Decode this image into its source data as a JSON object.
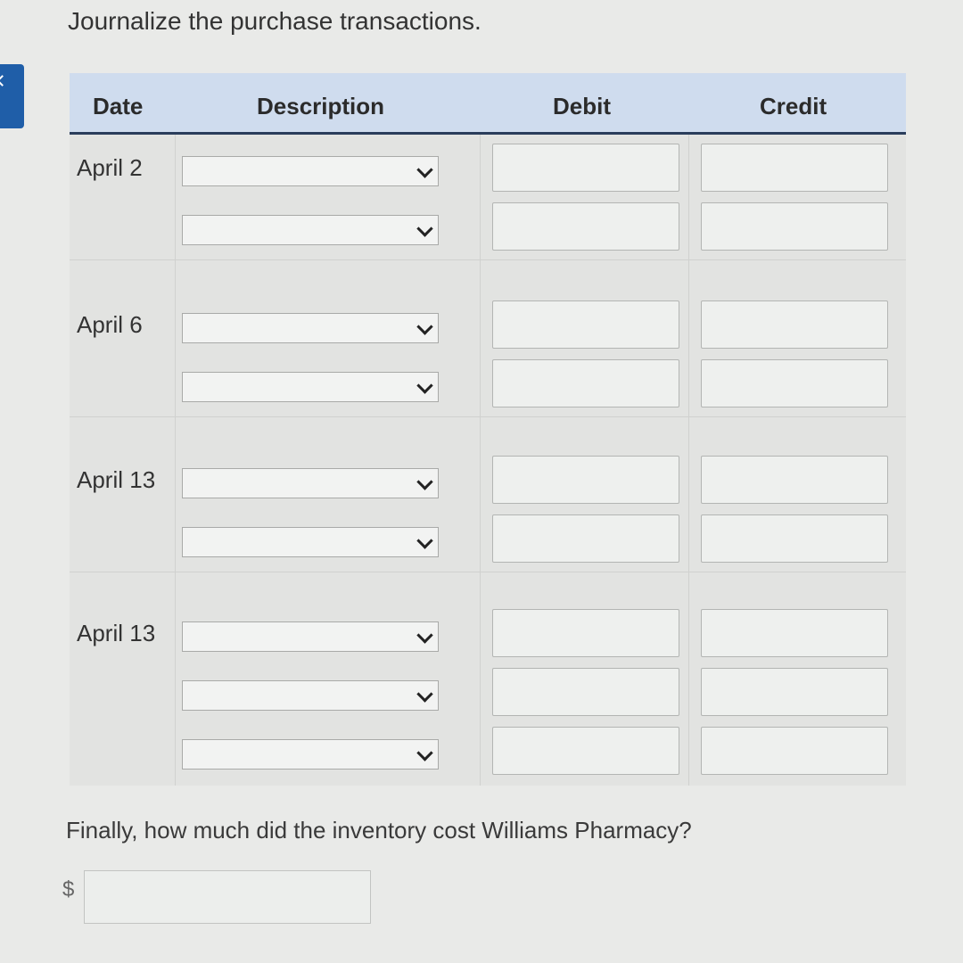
{
  "instruction": "Journalize the purchase transactions.",
  "headers": {
    "date": "Date",
    "description": "Description",
    "debit": "Debit",
    "credit": "Credit"
  },
  "entries": [
    {
      "date": "April 2",
      "lines": 2
    },
    {
      "date": "April 6",
      "lines": 2
    },
    {
      "date": "April 13",
      "lines": 2
    },
    {
      "date": "April 13",
      "lines": 3
    }
  ],
  "question": "Finally, how much did the inventory cost Williams Pharmacy?",
  "currency_symbol": "$",
  "colors": {
    "header_bg": "#cfdcee",
    "header_border": "#2a3d5b",
    "side_tab": "#1f5ea8"
  },
  "icons": {
    "dropdown": "chevron-down-icon",
    "side_tab": "chevron-left-icon"
  }
}
